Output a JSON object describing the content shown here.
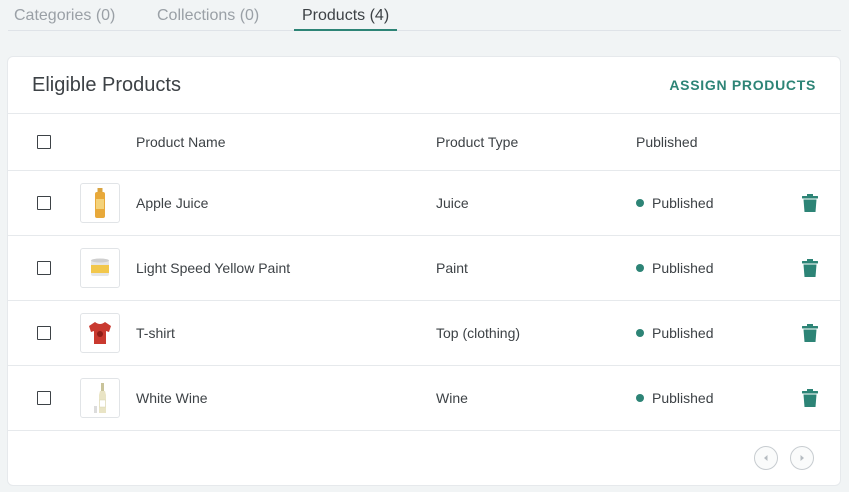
{
  "tabs": [
    {
      "label": "Categories (0)"
    },
    {
      "label": "Collections (0)"
    },
    {
      "label": "Products (4)"
    }
  ],
  "card": {
    "title": "Eligible Products",
    "assign_label": "ASSIGN PRODUCTS"
  },
  "table": {
    "headers": {
      "name": "Product Name",
      "type": "Product Type",
      "published": "Published"
    },
    "rows": [
      {
        "name": "Apple Juice",
        "type": "Juice",
        "status": "Published",
        "thumb": "juice-bottle-icon"
      },
      {
        "name": "Light Speed Yellow Paint",
        "type": "Paint",
        "status": "Published",
        "thumb": "paint-can-icon"
      },
      {
        "name": "T-shirt",
        "type": "Top (clothing)",
        "status": "Published",
        "thumb": "tshirt-icon"
      },
      {
        "name": "White Wine",
        "type": "Wine",
        "status": "Published",
        "thumb": "wine-bottle-icon"
      }
    ]
  },
  "colors": {
    "accent": "#2d8476",
    "text": "#3d4246",
    "background": "#f1f4f5"
  },
  "icons": {
    "delete": "trash-icon",
    "prev": "chevron-left-icon",
    "next": "chevron-right-icon"
  }
}
